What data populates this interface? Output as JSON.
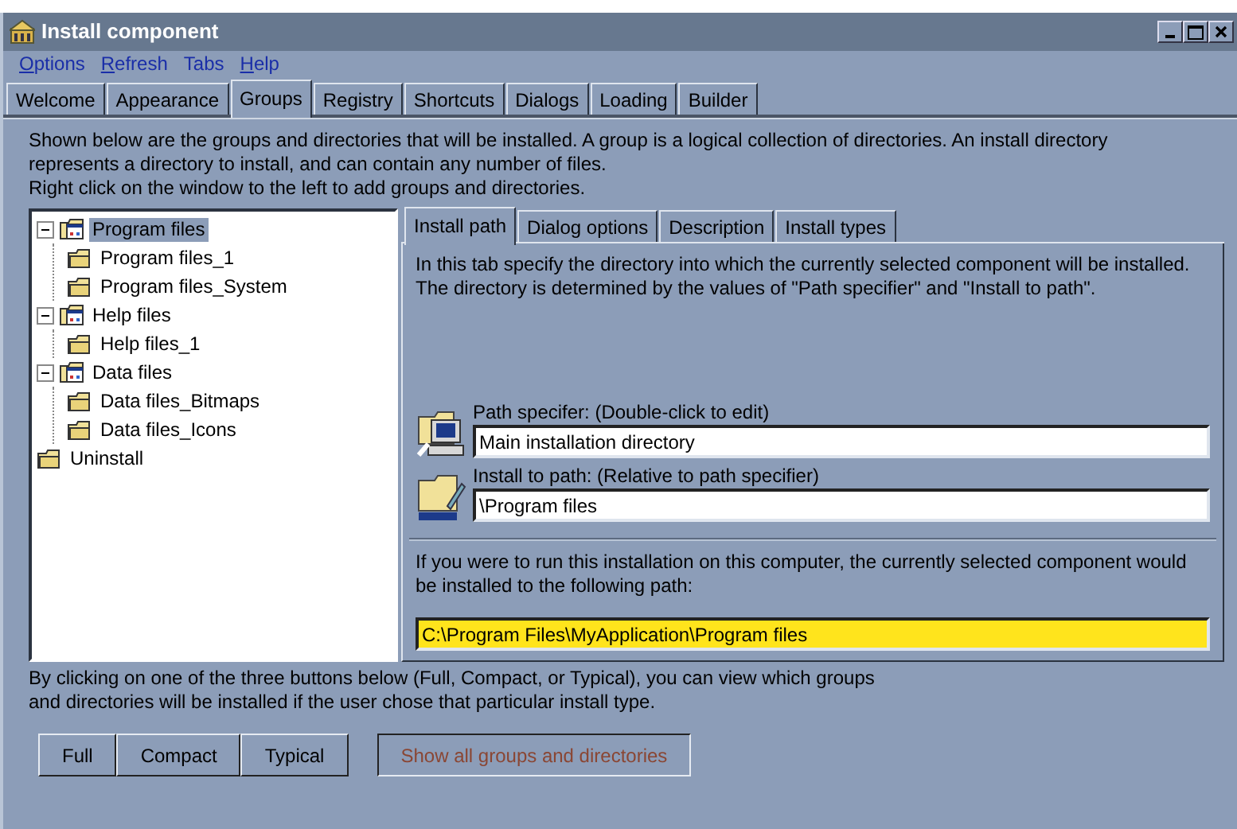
{
  "window": {
    "title": "Install component"
  },
  "menu": [
    {
      "label": "Options",
      "mnemonic": true
    },
    {
      "label": "Refresh",
      "mnemonic": true
    },
    {
      "label": "Tabs",
      "mnemonic": false
    },
    {
      "label": "Help",
      "mnemonic": true
    }
  ],
  "tabs": [
    {
      "label": "Welcome",
      "selected": false
    },
    {
      "label": "Appearance",
      "selected": false
    },
    {
      "label": "Groups",
      "selected": true
    },
    {
      "label": "Registry",
      "selected": false
    },
    {
      "label": "Shortcuts",
      "selected": false
    },
    {
      "label": "Dialogs",
      "selected": false
    },
    {
      "label": "Loading",
      "selected": false
    },
    {
      "label": "Builder",
      "selected": false
    }
  ],
  "intro": [
    "Shown below are the groups and directories that will be installed.  A group is a logical collection of directories.  An install directory",
    "represents a directory to install, and can contain any number of files.",
    "Right click on the window to the left to add groups and directories."
  ],
  "tree": [
    {
      "label": "Program files",
      "kind": "group",
      "selected": true,
      "expanded": true,
      "children": [
        {
          "label": "Program files_1",
          "kind": "directory",
          "selected": false
        },
        {
          "label": "Program files_System",
          "kind": "directory",
          "selected": false
        }
      ]
    },
    {
      "label": "Help files",
      "kind": "group",
      "selected": false,
      "expanded": true,
      "children": [
        {
          "label": "Help files_1",
          "kind": "directory",
          "selected": false
        }
      ]
    },
    {
      "label": "Data files",
      "kind": "group",
      "selected": false,
      "expanded": true,
      "children": [
        {
          "label": "Data files_Bitmaps",
          "kind": "directory",
          "selected": false
        },
        {
          "label": "Data files_Icons",
          "kind": "directory",
          "selected": false
        }
      ]
    },
    {
      "label": "Uninstall",
      "kind": "directory",
      "selected": false
    }
  ],
  "subtabs": [
    {
      "label": "Install path",
      "selected": true
    },
    {
      "label": "Dialog options",
      "selected": false
    },
    {
      "label": "Description",
      "selected": false
    },
    {
      "label": "Install types",
      "selected": false
    }
  ],
  "install_path": {
    "description": [
      "In this tab specify the directory into which the currently selected component will be installed.",
      "The directory is determined by the values of  \"Path specifier\" and \"Install to path\"."
    ],
    "fields": [
      {
        "label": "Path specifer: (Double-click to edit)",
        "value": "Main installation directory",
        "kind": "computer"
      },
      {
        "label": "Install to path: (Relative to path specifier)",
        "value": "\\Program files",
        "kind": "folder"
      }
    ],
    "result_text": [
      "If you were to run this installation on this computer, the currently selected component would",
      "be installed to the following path:"
    ],
    "result_path": "C:\\Program Files\\MyApplication\\Program files"
  },
  "footer_text": [
    "By clicking on one of the three buttons below (Full, Compact, or Typical), you can view which groups",
    "and directories will be installed if the user chose that particular install type."
  ],
  "type_buttons": [
    {
      "label": "Full",
      "pressed": false
    },
    {
      "label": "Compact",
      "pressed": false
    },
    {
      "label": "Typical",
      "pressed": false
    }
  ],
  "show_all_button": {
    "label": "Show all groups and directories",
    "pressed": true
  }
}
